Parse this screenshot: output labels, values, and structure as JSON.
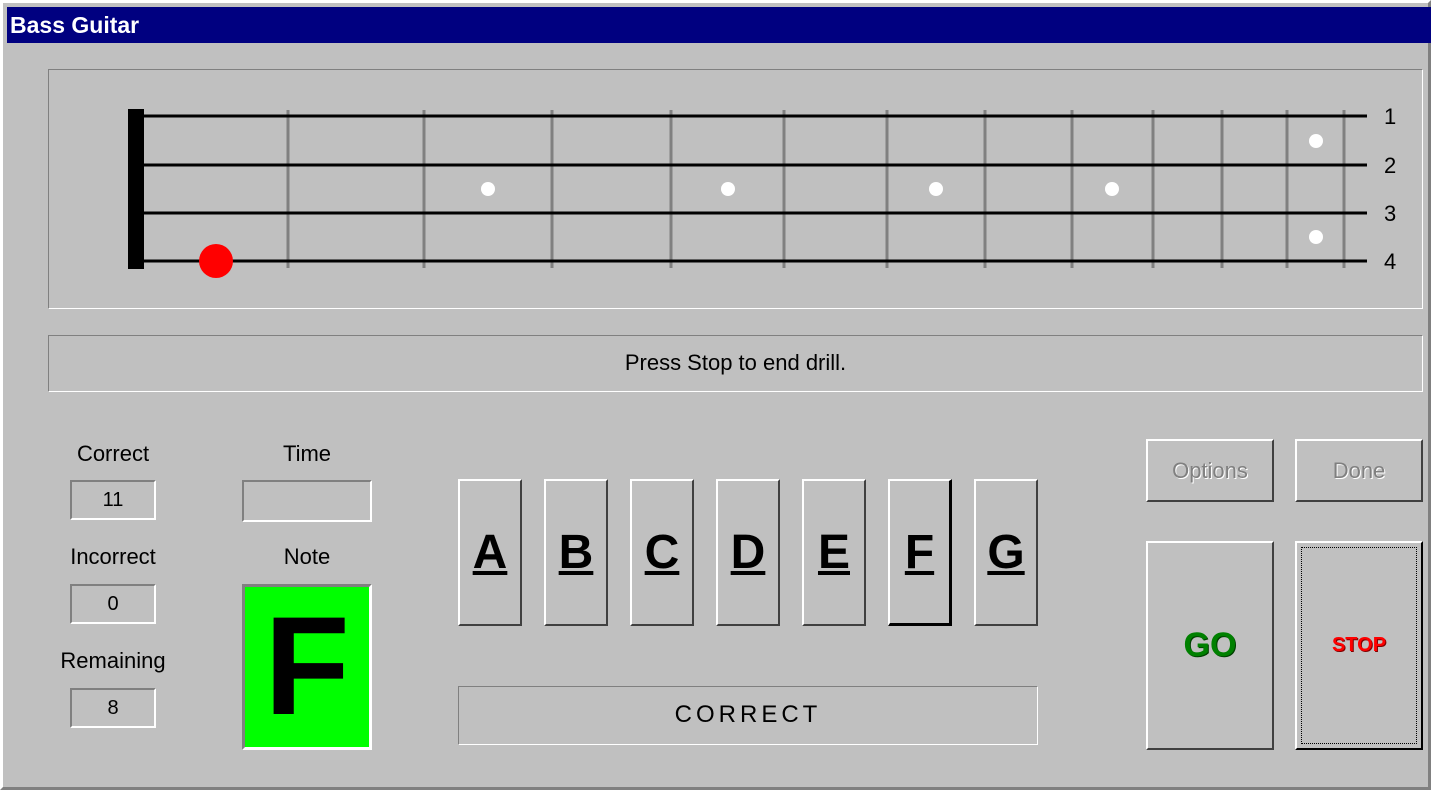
{
  "window": {
    "title": "Bass Guitar"
  },
  "fretboard": {
    "string_labels": [
      "1",
      "2",
      "3",
      "4"
    ],
    "marker_color": "#ff0000",
    "inlay_color": "#ffffff",
    "current_note": {
      "string": 4,
      "fret": 1
    }
  },
  "status": {
    "message": "Press Stop to end drill."
  },
  "stats": {
    "correct_label": "Correct",
    "correct_value": "11",
    "incorrect_label": "Incorrect",
    "incorrect_value": "0",
    "remaining_label": "Remaining",
    "remaining_value": "8",
    "time_label": "Time",
    "time_value": "",
    "note_label": "Note",
    "note_value": "F",
    "note_bg_color": "#00ff00"
  },
  "note_buttons": [
    "A",
    "B",
    "C",
    "D",
    "E",
    "F",
    "G"
  ],
  "selected_note": "F",
  "result": {
    "text": "CORRECT"
  },
  "controls": {
    "options_label": "Options",
    "done_label": "Done",
    "go_label": "GO",
    "stop_label": "STOP",
    "go_color": "#008000",
    "stop_color": "#ff0000"
  }
}
